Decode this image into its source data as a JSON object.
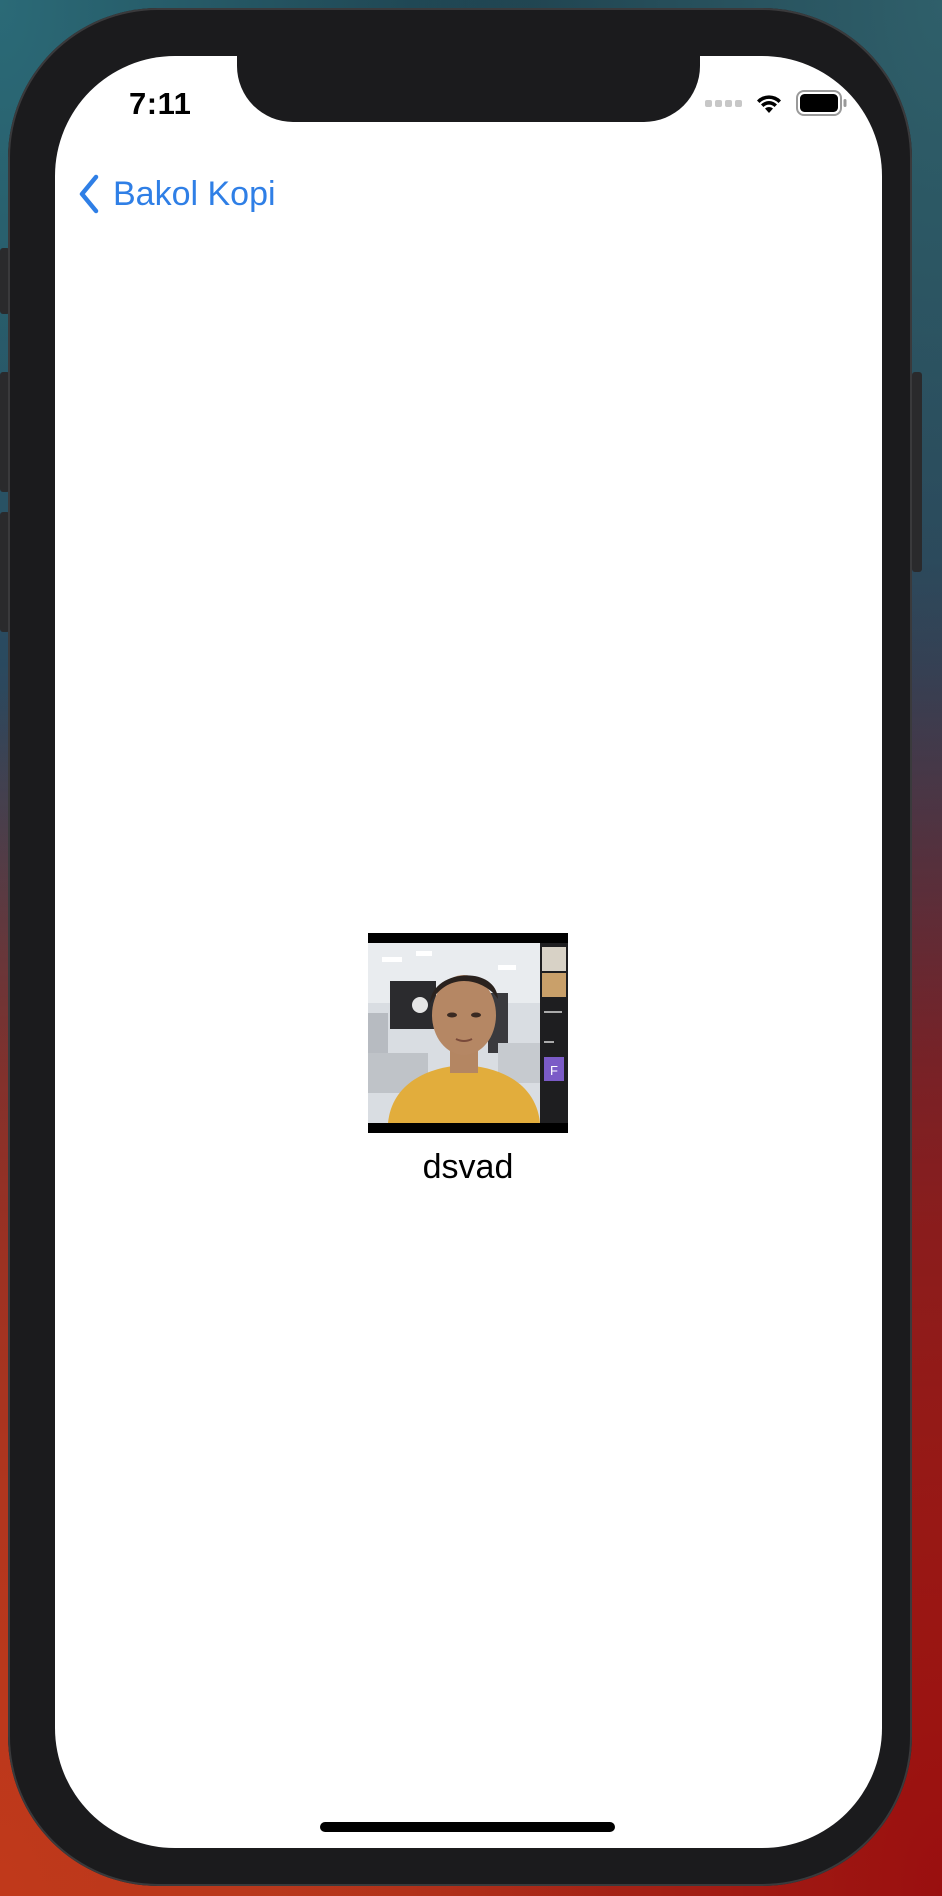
{
  "status_bar": {
    "time": "7:11",
    "signal_icon": "cellular-signal-icon",
    "wifi_icon": "wifi-icon",
    "battery_icon": "battery-icon"
  },
  "nav": {
    "back_label": "Bakol Kopi",
    "back_icon": "chevron-left-icon",
    "accent_color": "#2f7fe6"
  },
  "content": {
    "photo_alt": "dsvad photo",
    "caption": "dsvad"
  }
}
